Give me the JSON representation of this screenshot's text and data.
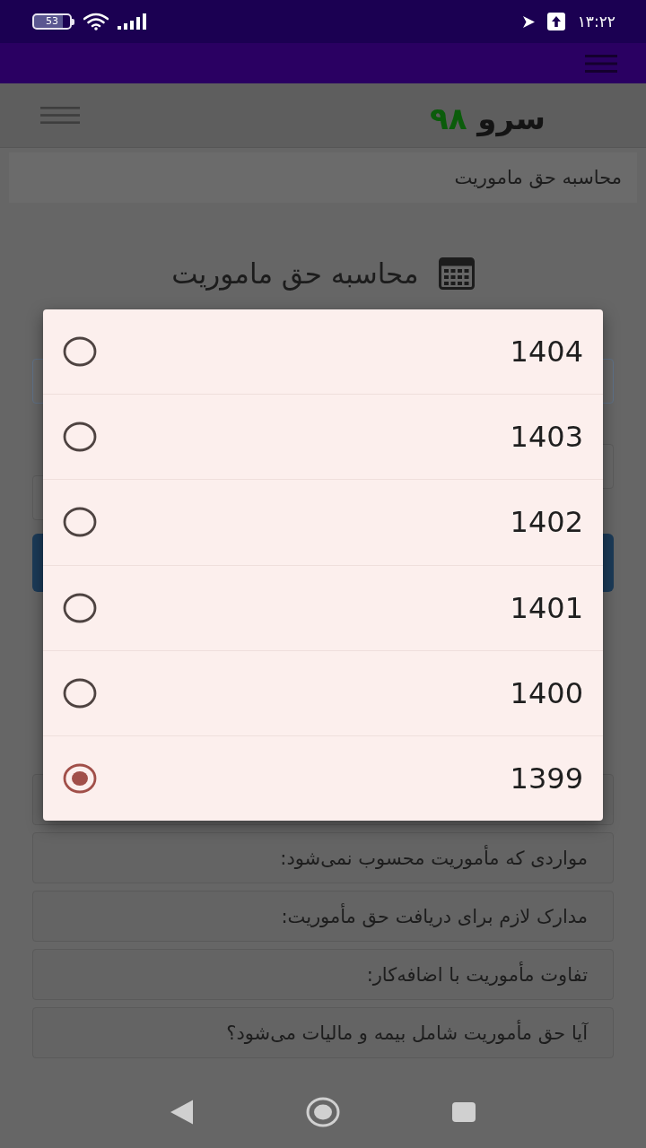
{
  "status_bar": {
    "battery": "53",
    "time": "۱۳:۲۲"
  },
  "header": {
    "logo_word": "سرو",
    "logo_number": "۹۸"
  },
  "breadcrumb": "محاسبه حق ماموریت",
  "heading": "محاسبه حق ماموریت",
  "year_dialog": {
    "options": [
      {
        "label": "1404",
        "selected": false
      },
      {
        "label": "1403",
        "selected": false
      },
      {
        "label": "1402",
        "selected": false
      },
      {
        "label": "1401",
        "selected": false
      },
      {
        "label": "1400",
        "selected": false
      },
      {
        "label": "1399",
        "selected": true
      }
    ]
  },
  "accordion": [
    {
      "title": "مواردی که مأموریت محسوب نمی‌شود:"
    },
    {
      "title": "مدارک لازم برای دریافت حق مأموریت:"
    },
    {
      "title": "تفاوت مأموریت با اضافه‌کار:"
    },
    {
      "title": "آیا حق مأموریت شامل بیمه و مالیات می‌شود؟"
    }
  ]
}
